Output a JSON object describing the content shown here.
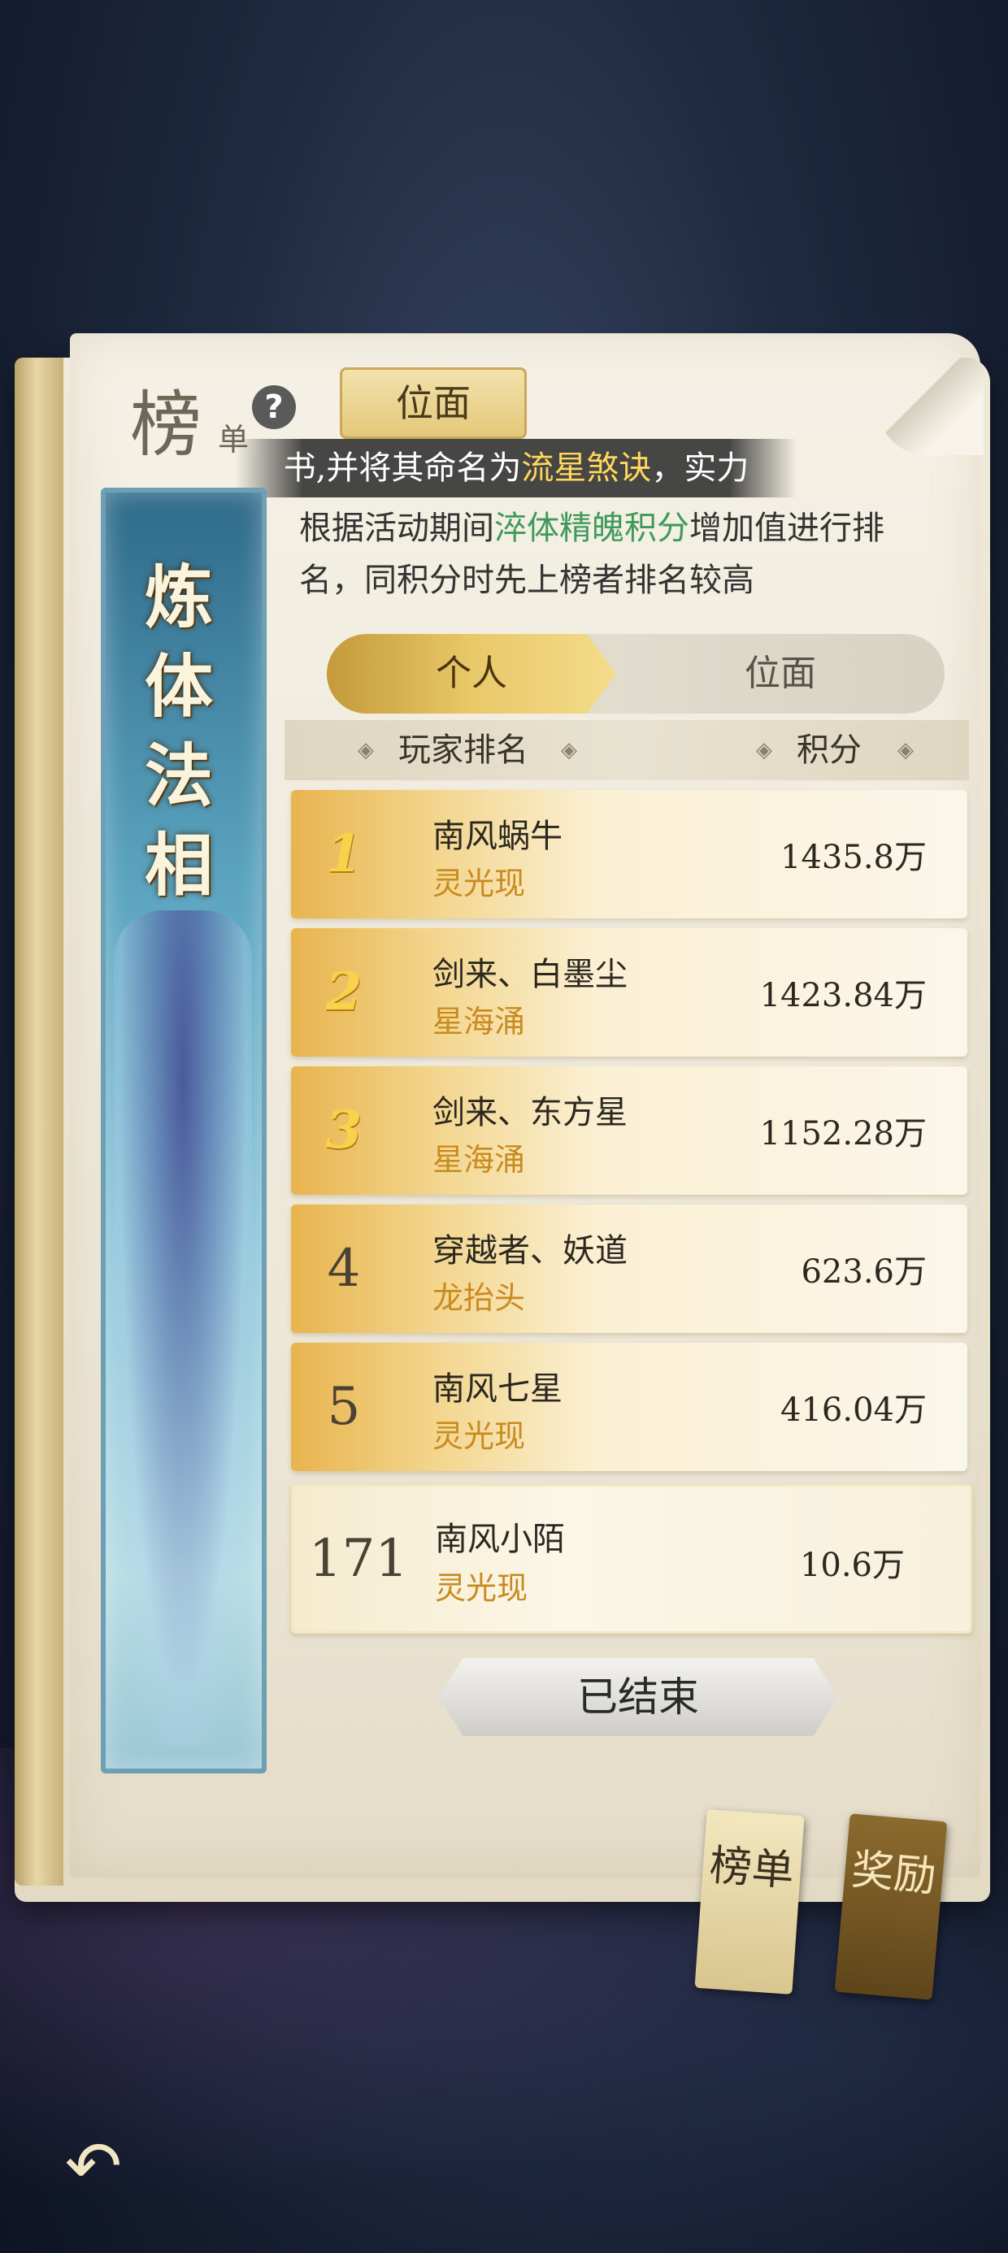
{
  "header": {
    "title_main": "榜",
    "title_sub": "单",
    "help_icon": "question-icon",
    "plane_tab_label": "位面"
  },
  "marquee": {
    "prefix": "书,并将其命名为",
    "highlight": "流星煞诀",
    "suffix": "，实力"
  },
  "description": {
    "part1": "根据活动期间",
    "highlight": "淬体精魄积分",
    "part2": "增加值进行排名，同积分时先上榜者排名较高"
  },
  "banner": {
    "title": "炼体法相"
  },
  "toggle": {
    "personal": "个人",
    "plane": "位面"
  },
  "columns": {
    "player": "玩家排名",
    "score": "积分"
  },
  "rows": [
    {
      "rank": "1",
      "name": "南风蜗牛",
      "title": "灵光现",
      "score": "1435.8万"
    },
    {
      "rank": "2",
      "name": "剑来、白墨尘",
      "title": "星海涌",
      "score": "1423.84万"
    },
    {
      "rank": "3",
      "name": "剑来、东方星",
      "title": "星海涌",
      "score": "1152.28万"
    },
    {
      "rank": "4",
      "name": "穿越者、妖道",
      "title": "龙抬头",
      "score": "623.6万"
    },
    {
      "rank": "5",
      "name": "南风七星",
      "title": "灵光现",
      "score": "416.04万"
    }
  ],
  "my_row": {
    "rank": "171",
    "name": "南风小陌",
    "title": "灵光现",
    "score": "10.6万"
  },
  "ended_label": "已结束",
  "tags": {
    "ranking": "榜单",
    "reward": "奖励"
  },
  "back_icon": "back-arrow-icon"
}
